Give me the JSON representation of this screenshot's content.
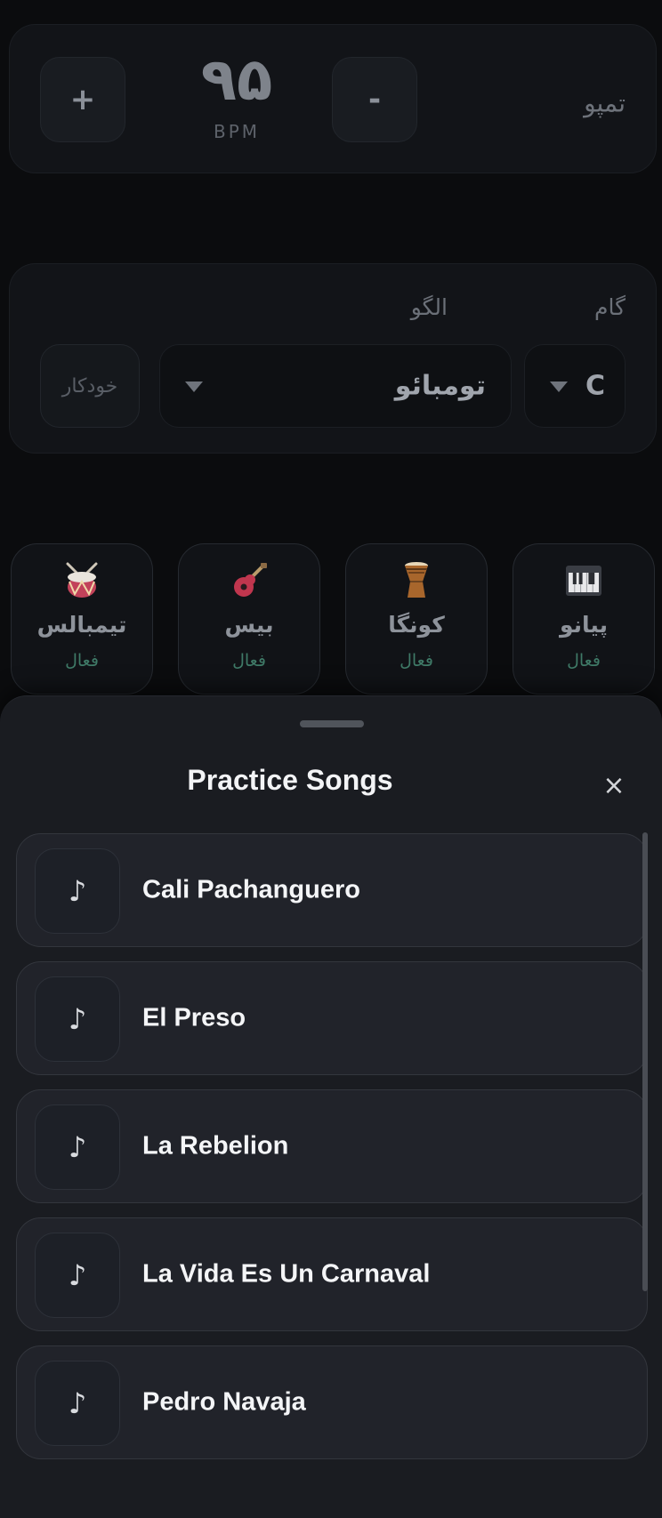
{
  "tempo": {
    "label": "تمپو",
    "value": "۹۵",
    "unit": "BPM",
    "increase_label": "+",
    "decrease_label": "-"
  },
  "pattern_panel": {
    "scale_label": "گام",
    "scale_value": "C",
    "pattern_label": "الگو",
    "pattern_value": "تومبائو",
    "auto_label": "خودکار"
  },
  "instruments": [
    {
      "name": "پیانو",
      "state": "فعال",
      "icon": "piano-icon"
    },
    {
      "name": "کونگا",
      "state": "فعال",
      "icon": "conga-drum-icon"
    },
    {
      "name": "بیس",
      "state": "فعال",
      "icon": "guitar-icon"
    },
    {
      "name": "تیمبالس",
      "state": "فعال",
      "icon": "drum-icon"
    }
  ],
  "sheet": {
    "title": "Practice Songs",
    "close_label": "×",
    "note_glyph": "♪",
    "songs": [
      {
        "title": "Cali Pachanguero"
      },
      {
        "title": "El Preso"
      },
      {
        "title": "La Rebelion"
      },
      {
        "title": "La Vida Es Un Carnaval"
      },
      {
        "title": "Pedro Navaja"
      }
    ]
  },
  "colors": {
    "background": "#0b0c0e",
    "card": "#121418",
    "sheet": "#1a1c21",
    "active_state": "#3f7a67"
  }
}
